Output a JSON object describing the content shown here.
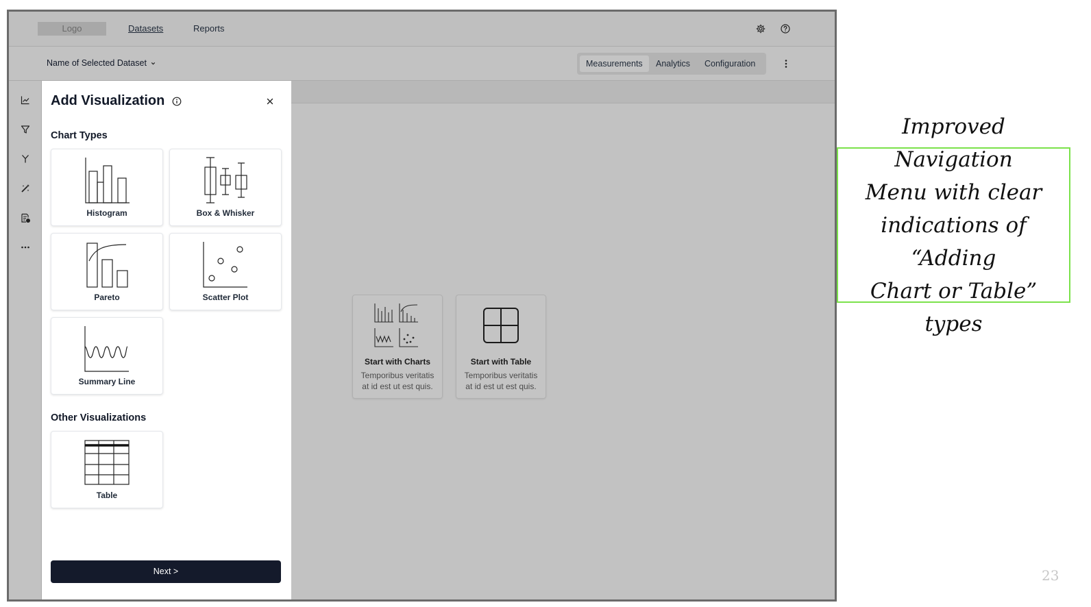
{
  "topnav": {
    "logo": "Logo",
    "links": [
      "Datasets",
      "Reports"
    ],
    "icons": [
      "gear-icon",
      "help-icon"
    ]
  },
  "subheader": {
    "dataset_name": "Name of Selected Dataset",
    "tabs": [
      "Measurements",
      "Analytics",
      "Configuration"
    ],
    "active_tab": "Measurements"
  },
  "rail": {
    "icons": [
      "line-chart-icon",
      "filter-icon",
      "merge-icon",
      "magic-icon",
      "report-icon",
      "more-icon"
    ]
  },
  "panel": {
    "title": "Add Visualization",
    "chart_section": "Chart Types",
    "chart_types": [
      "Histogram",
      "Box & Whisker",
      "Pareto",
      "Scatter Plot",
      "Summary Line"
    ],
    "other_section": "Other Visualizations",
    "other_types": [
      "Table"
    ],
    "next_label": "Next >"
  },
  "workspace": {
    "cards": [
      {
        "title": "Start with Charts",
        "desc": "Temporibus veritatis at id est ut est quis."
      },
      {
        "title": "Start with Table",
        "desc": "Temporibus veritatis at id est ut est quis."
      }
    ]
  },
  "annotation": {
    "lines": [
      "Improved Navigation",
      "Menu with clear",
      "indications of “Adding",
      "Chart or Table” types"
    ],
    "color": "#7be24a"
  },
  "page_number": "23"
}
